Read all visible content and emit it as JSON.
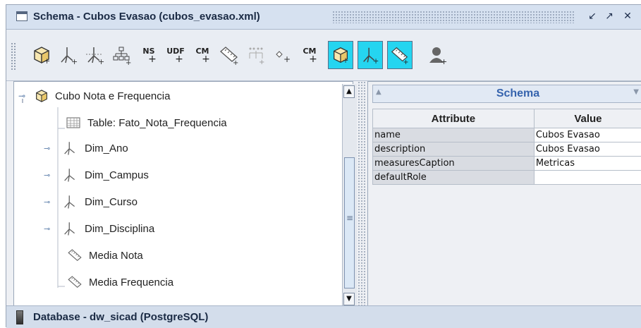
{
  "window": {
    "title": "Schema - Cubos Evasao (cubos_evasao.xml)",
    "controls": {
      "restore": "↙",
      "maximize": "↗",
      "close": "✕"
    }
  },
  "toolbar": {
    "buttons": [
      {
        "icon": "add-cube-icon",
        "label": ""
      },
      {
        "icon": "add-dimension-icon",
        "label": ""
      },
      {
        "icon": "add-dimension-usage-icon",
        "label": ""
      },
      {
        "icon": "add-hierarchy-icon",
        "label": ""
      },
      {
        "icon": "add-named-set-icon",
        "label": "NS"
      },
      {
        "icon": "add-udf-icon",
        "label": "UDF"
      },
      {
        "icon": "add-calculated-member-icon",
        "label": "CM"
      },
      {
        "icon": "add-measure-icon",
        "label": ""
      },
      {
        "icon": "add-level-icon",
        "label": ""
      },
      {
        "icon": "add-property-icon",
        "label": ""
      },
      {
        "icon": "add-calc-member-prop-icon",
        "label": "CM"
      },
      {
        "icon": "add-virtual-cube-icon",
        "label": ""
      },
      {
        "icon": "add-virtual-dimension-icon",
        "label": ""
      },
      {
        "icon": "add-virtual-measure-icon",
        "label": ""
      },
      {
        "icon": "add-role-icon",
        "label": ""
      }
    ]
  },
  "tree": {
    "root": {
      "label": "Cubo Nota e Frequencia",
      "icon": "cube-icon"
    },
    "items": [
      {
        "label": "Table: Fato_Nota_Frequencia",
        "icon": "table-icon"
      },
      {
        "label": "Dim_Ano",
        "icon": "dimension-icon"
      },
      {
        "label": "Dim_Campus",
        "icon": "dimension-icon"
      },
      {
        "label": "Dim_Curso",
        "icon": "dimension-icon"
      },
      {
        "label": "Dim_Disciplina",
        "icon": "dimension-icon"
      },
      {
        "label": "Media Nota",
        "icon": "measure-icon"
      },
      {
        "label": "Media Frequencia",
        "icon": "measure-icon"
      }
    ]
  },
  "properties": {
    "header": "Schema",
    "columns": {
      "attribute": "Attribute",
      "value": "Value"
    },
    "rows": [
      {
        "attribute": "name",
        "value": "Cubos Evasao"
      },
      {
        "attribute": "description",
        "value": "Cubos Evasao"
      },
      {
        "attribute": "measuresCaption",
        "value": "Metricas"
      },
      {
        "attribute": "defaultRole",
        "value": ""
      }
    ]
  },
  "status": {
    "text": "Database - dw_sicad (PostgreSQL)"
  }
}
